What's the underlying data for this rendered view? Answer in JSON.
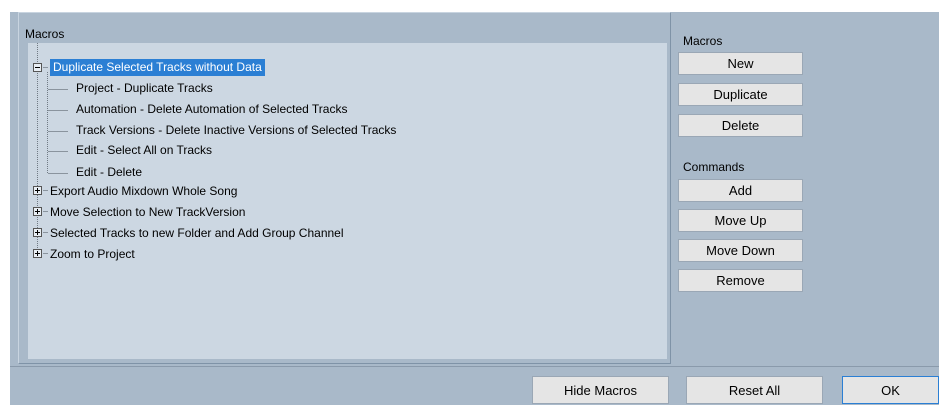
{
  "macros_group": {
    "label": "Macros",
    "tree": [
      {
        "label": "Duplicate Selected Tracks without Data",
        "expanded": true,
        "selected": true,
        "children": [
          "Project - Duplicate Tracks",
          "Automation - Delete Automation of Selected Tracks",
          "Track Versions - Delete Inactive Versions of Selected Tracks",
          "Edit - Select All on Tracks",
          "Edit - Delete"
        ]
      },
      {
        "label": "Export Audio Mixdown Whole Song",
        "expanded": false
      },
      {
        "label": "Move Selection to New TrackVersion",
        "expanded": false
      },
      {
        "label": "Selected Tracks to new Folder and Add Group Channel",
        "expanded": false
      },
      {
        "label": "Zoom to Project",
        "expanded": false
      }
    ]
  },
  "macros_panel": {
    "label": "Macros",
    "new_label": "New",
    "duplicate_label": "Duplicate",
    "delete_label": "Delete"
  },
  "commands_panel": {
    "label": "Commands",
    "add_label": "Add",
    "move_up_label": "Move Up",
    "move_down_label": "Move Down",
    "remove_label": "Remove"
  },
  "footer": {
    "hide_macros_label": "Hide Macros",
    "reset_all_label": "Reset All",
    "ok_label": "OK"
  },
  "colors": {
    "dialog_background": "#a9b9c9",
    "tree_background": "#ccd7e2",
    "selection": "#2b7fd4",
    "button_face": "#e5e5e5"
  }
}
